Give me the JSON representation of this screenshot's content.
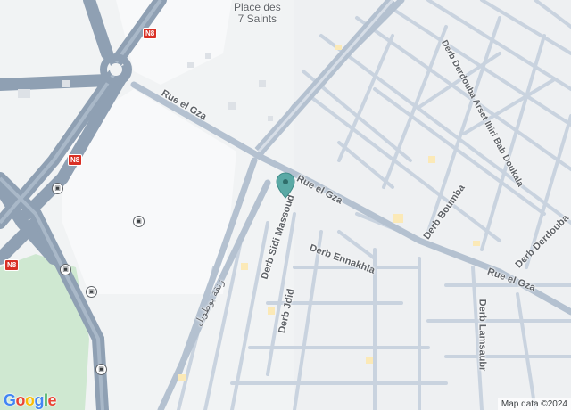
{
  "map": {
    "place_name": "Place des\n7 Saints",
    "streets": {
      "rue_el_gza_1": "Rue el Gza",
      "rue_el_gza_2": "Rue el Gza",
      "rue_el_gza_3": "Rue el Gza",
      "derb_sidi_massoud": "Derb Sidi Massoud",
      "derb_ennakhla": "Derb Ennakhla",
      "derb_jdid": "Derb Jdid",
      "derb_boumba": "Derb Boumba",
      "derb_lamsaubr": "Derb Lamsaubr",
      "derb_derdouba_arset": "Derb Derdouba Arset Ihiri Bab Doukala",
      "derb_derdouba": "Derb Derdouba",
      "arabic_street": "زنقة بوطويل"
    },
    "route_shields": [
      "N8",
      "N8",
      "N8"
    ],
    "bus_icons": 5,
    "logo": "Google",
    "attribution": "Map data ©2024"
  },
  "colors": {
    "background": "#f1f3f4",
    "major_road": "#8fa0b3",
    "minor_road": "#c9d3df",
    "park": "#cfe8d1",
    "pin": "#5aa9a5",
    "shield": "#d93025"
  }
}
